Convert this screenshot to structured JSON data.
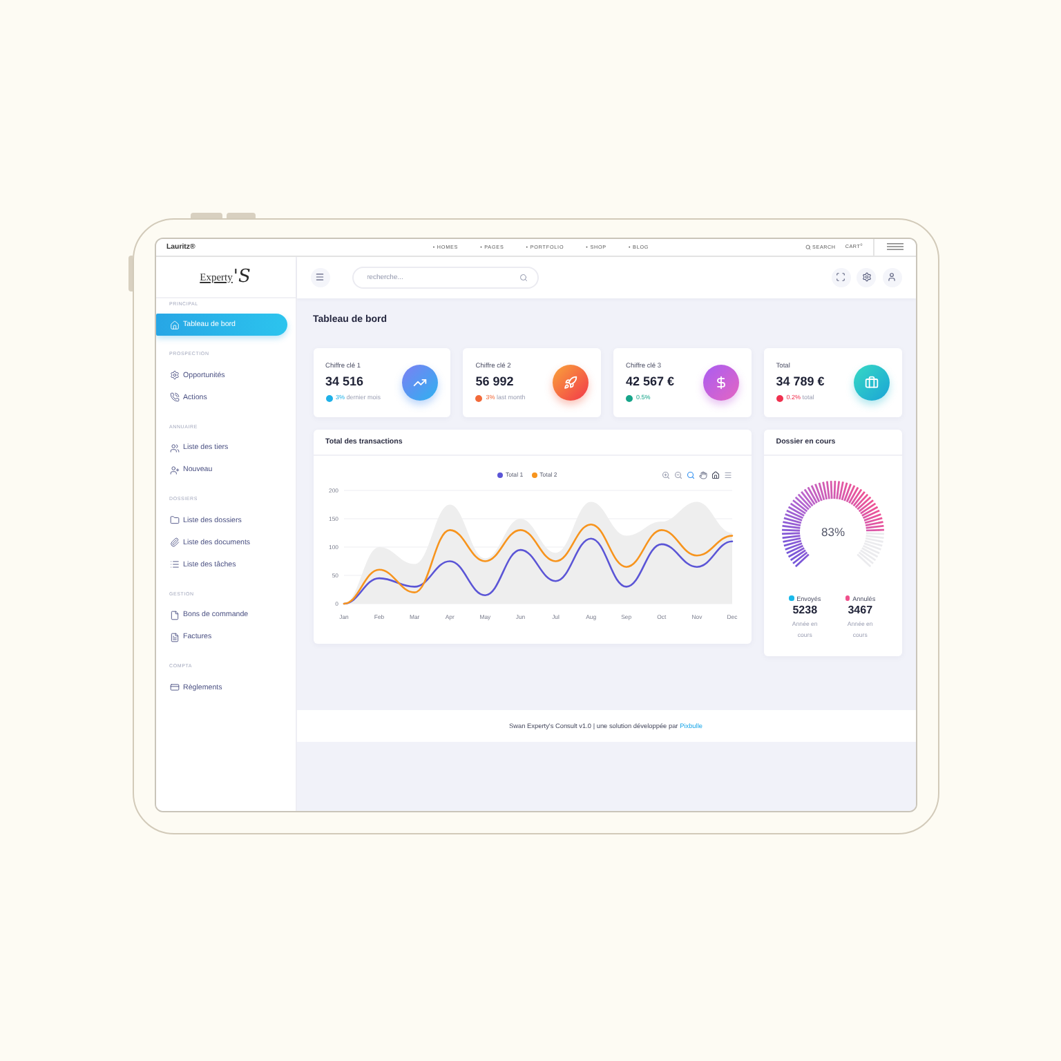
{
  "browser_bar": {
    "brand": "Lauritz®",
    "nav": [
      "• HOMES",
      "• PAGES",
      "• PORTFOLIO",
      "• SHOP",
      "• BLOG"
    ],
    "search": "SEARCH",
    "cart": "CART$^{0}$"
  },
  "logo": {
    "name": "Experty",
    "mark": "'S"
  },
  "sidebar": {
    "sections": [
      {
        "title": "PRINCIPAL",
        "items": [
          {
            "label": "Tableau de bord",
            "selected": true
          }
        ]
      },
      {
        "title": "PROSPECTION",
        "items": [
          {
            "label": "Opportunités",
            "selected": false
          },
          {
            "label": "Actions",
            "selected": false
          }
        ]
      },
      {
        "title": "ANNUAIRE",
        "items": [
          {
            "label": "Liste des tiers",
            "selected": false
          },
          {
            "label": "Nouveau",
            "selected": false
          }
        ]
      },
      {
        "title": "DOSSIERS",
        "items": [
          {
            "label": "Liste des dossiers",
            "selected": false
          },
          {
            "label": "Liste des documents",
            "selected": false
          },
          {
            "label": "Liste des tâches",
            "selected": false
          }
        ]
      },
      {
        "title": "GESTION",
        "items": [
          {
            "label": "Bons de commande",
            "selected": false
          },
          {
            "label": "Factures",
            "selected": false
          }
        ]
      },
      {
        "title": "COMPTA",
        "items": [
          {
            "label": "Règlements",
            "selected": false
          }
        ]
      }
    ]
  },
  "header": {
    "search": {
      "placeholder": "recherche..."
    }
  },
  "page_title": "Tableau de bord",
  "stats": [
    {
      "label": "Chiffre clé 1",
      "value": "34 516",
      "change": "3%",
      "note": "dernier mois",
      "color": "#1fb1e8"
    },
    {
      "label": "Chiffre clé 2",
      "value": "56 992",
      "change": "3%",
      "note": "last month",
      "color": "#f26a3a"
    },
    {
      "label": "Chiffre clé 3",
      "value": "42 567 €",
      "change": "0.5%",
      "color": "#17a58a"
    },
    {
      "label": "Total",
      "value": "34 789 €",
      "change": "0.2%",
      "note": "total",
      "color": "#f0314f"
    }
  ],
  "transactions": {
    "title": "Total des transactions",
    "chart_data": {
      "type": "line",
      "grid": true,
      "categories": [
        "Jan",
        "Feb",
        "Mar",
        "Apr",
        "May",
        "Jun",
        "Jul",
        "Aug",
        "Sep",
        "Oct",
        "Nov",
        "Dec"
      ],
      "ylim": [
        0,
        200
      ],
      "yticks": [
        0,
        50,
        100,
        150,
        200
      ],
      "series": [
        {
          "name": "Total 1",
          "color": "#5b55d6",
          "values": [
            0,
            45,
            30,
            75,
            15,
            95,
            40,
            115,
            30,
            105,
            65,
            110
          ]
        },
        {
          "name": "Total 2",
          "color": "#f7941d",
          "values": [
            0,
            60,
            20,
            130,
            75,
            130,
            75,
            140,
            65,
            130,
            85,
            120
          ]
        },
        {
          "type": "area",
          "color": "#eeeeee",
          "values": [
            0,
            100,
            70,
            175,
            80,
            150,
            90,
            180,
            120,
            145,
            180,
            125
          ]
        }
      ]
    }
  },
  "dossiers": {
    "title": "Dossier en cours",
    "reading": "83%",
    "chart_data": {
      "type": "donut",
      "values": [
        83,
        17
      ]
    },
    "legend": [
      {
        "label": "Envoyés",
        "value": "5238",
        "note": "Année en cours",
        "color": "#1ab9ea"
      },
      {
        "label": "Annulés",
        "value": "3467",
        "note": "Année en cours",
        "color": "#f0508c"
      }
    ]
  },
  "footer": {
    "text": "Swan Experty's Consult v1.0 | une solution développée par",
    "link": "Pixbulle"
  }
}
